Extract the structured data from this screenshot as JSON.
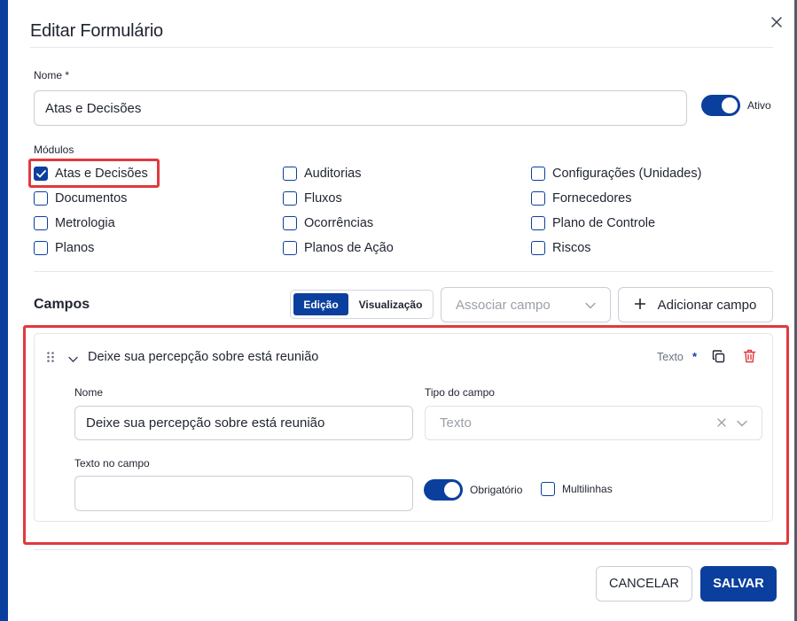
{
  "dialog": {
    "title": "Editar Formulário"
  },
  "name_field": {
    "label": "Nome *",
    "value": "Atas e Decisões"
  },
  "active_toggle": {
    "label": "Ativo",
    "on": true
  },
  "modules": {
    "label": "Módulos",
    "items": [
      {
        "label": "Atas e Decisões",
        "checked": true
      },
      {
        "label": "Auditorias",
        "checked": false
      },
      {
        "label": "Configurações (Unidades)",
        "checked": false
      },
      {
        "label": "Documentos",
        "checked": false
      },
      {
        "label": "Fluxos",
        "checked": false
      },
      {
        "label": "Fornecedores",
        "checked": false
      },
      {
        "label": "Metrologia",
        "checked": false
      },
      {
        "label": "Ocorrências",
        "checked": false
      },
      {
        "label": "Plano de Controle",
        "checked": false
      },
      {
        "label": "Planos",
        "checked": false
      },
      {
        "label": "Planos de Ação",
        "checked": false
      },
      {
        "label": "Riscos",
        "checked": false
      }
    ]
  },
  "fields": {
    "title": "Campos",
    "tabs": [
      {
        "label": "Edição",
        "active": true
      },
      {
        "label": "Visualização",
        "active": false
      }
    ],
    "associate_placeholder": "Associar campo",
    "add_button": "Adicionar campo",
    "field": {
      "header": "Deixe sua percepção sobre está reunião",
      "type_badge": "Texto",
      "required_mark": "*",
      "name_label": "Nome",
      "name_value": "Deixe sua percepção sobre está reunião",
      "type_label": "Tipo do campo",
      "type_value": "Texto",
      "placeholder_label": "Texto no campo",
      "placeholder_value": "",
      "required_label": "Obrigatório",
      "multiline_label": "Multilinhas"
    }
  },
  "footer": {
    "cancel": "CANCELAR",
    "save": "SALVAR"
  },
  "colors": {
    "primary": "#0b3f9e",
    "highlight": "#e0393e",
    "danger": "#e0393e"
  }
}
